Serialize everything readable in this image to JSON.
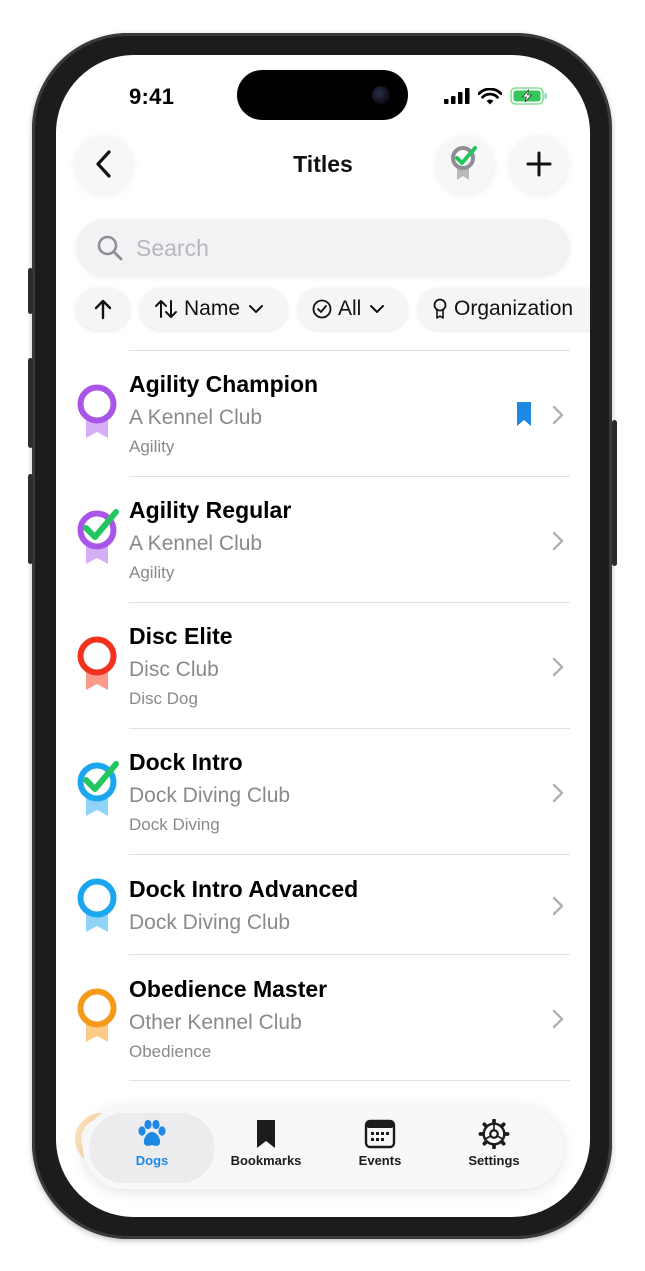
{
  "status_bar": {
    "time": "9:41"
  },
  "nav": {
    "title": "Titles"
  },
  "search": {
    "placeholder": "Search"
  },
  "filters": {
    "name_label": "Name",
    "status_label": "All",
    "organization_label": "Organization"
  },
  "titles": [
    {
      "name": "Agility Champion",
      "organization": "A Kennel Club",
      "sport": "Agility",
      "ribbon_color": "#a855e8",
      "ribbon_tail_color": "#d6aef5",
      "earned": false,
      "bookmarked": true
    },
    {
      "name": "Agility Regular",
      "organization": "A Kennel Club",
      "sport": "Agility",
      "ribbon_color": "#a855e8",
      "ribbon_tail_color": "#d6aef5",
      "earned": true,
      "bookmarked": false
    },
    {
      "name": "Disc Elite",
      "organization": "Disc Club",
      "sport": "Disc Dog",
      "ribbon_color": "#f0321e",
      "ribbon_tail_color": "#fb9a8a",
      "earned": false,
      "bookmarked": false
    },
    {
      "name": "Dock Intro",
      "organization": "Dock Diving Club",
      "sport": "Dock Diving",
      "ribbon_color": "#1aa7f0",
      "ribbon_tail_color": "#8fd3f7",
      "earned": true,
      "bookmarked": false
    },
    {
      "name": "Dock Intro Advanced",
      "organization": "Dock Diving Club",
      "sport": "",
      "ribbon_color": "#1aa7f0",
      "ribbon_tail_color": "#8fd3f7",
      "earned": false,
      "bookmarked": false
    },
    {
      "name": "Obedience Master",
      "organization": "Other Kennel Club",
      "sport": "Obedience",
      "ribbon_color": "#f59a1a",
      "ribbon_tail_color": "#fbc98a",
      "earned": false,
      "bookmarked": false
    }
  ],
  "tabbar": {
    "tabs": [
      {
        "label": "Dogs",
        "icon": "paw-icon",
        "active": true
      },
      {
        "label": "Bookmarks",
        "icon": "bookmark-icon",
        "active": false
      },
      {
        "label": "Events",
        "icon": "calendar-icon",
        "active": false
      },
      {
        "label": "Settings",
        "icon": "gear-icon",
        "active": false
      }
    ]
  },
  "colors": {
    "accent": "#1e88e5",
    "bookmark": "#1e88e5",
    "checkmark": "#22c55e",
    "secondary_text": "#8a8a8e"
  }
}
